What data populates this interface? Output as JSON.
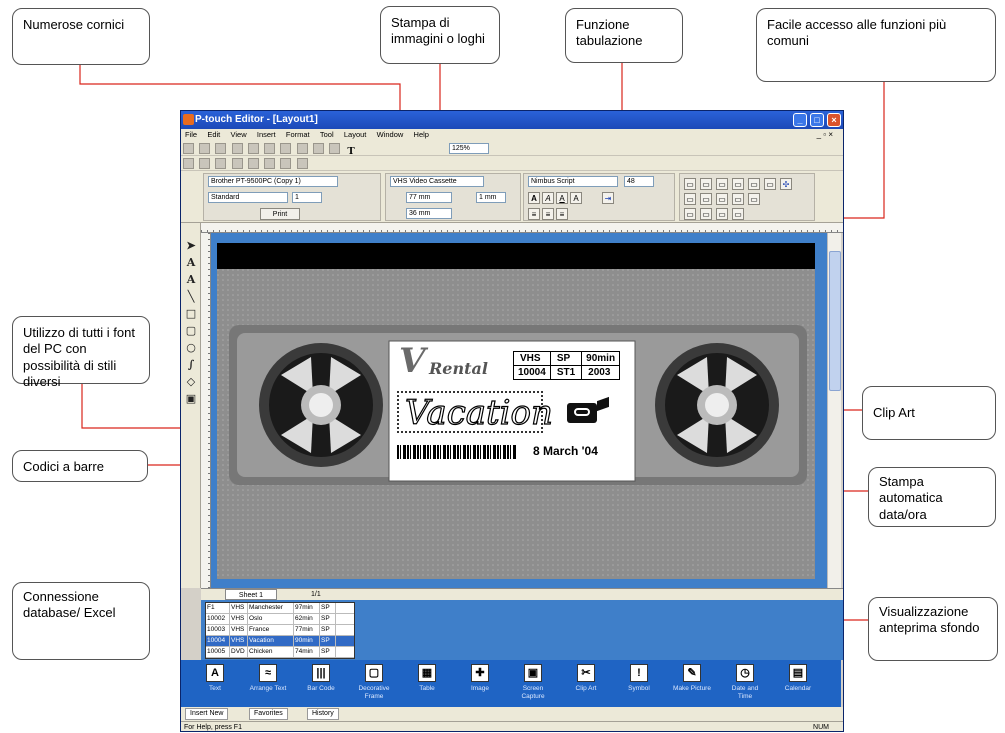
{
  "callouts": {
    "cornici": "Numerose cornici",
    "stampa_immagini": "Stampa di immagini o loghi",
    "tabulazione": "Funzione tabulazione",
    "accesso": "Facile accesso alle funzioni più comuni",
    "font": "Utilizzo di tutti i font del PC con possibilità di stili diversi",
    "clipart": "Clip Art",
    "barcode": "Codici a barre",
    "data_ora": "Stampa automatica data/ora",
    "database": "Connessione database/ Excel",
    "anteprima": "Visualizzazione anteprima sfondo"
  },
  "window": {
    "title": "P-touch Editor - [Layout1]",
    "menu": [
      "File",
      "Edit",
      "View",
      "Insert",
      "Format",
      "Tool",
      "Layout",
      "Window",
      "Help"
    ],
    "zoom": "125%",
    "toolbar_glyph": "T"
  },
  "properties": {
    "printer": "Brother PT-9500PC (Copy 1)",
    "mode": "Standard",
    "copies": "1",
    "print_label": "Print",
    "media": "VHS Video Cassette",
    "width": "77 mm",
    "margin": "1 mm",
    "height": "36 mm",
    "font": "Nimbus Script",
    "font_size": "48"
  },
  "label": {
    "logo_text": "Rental",
    "logo_initial": "V",
    "title_text": "Vacation",
    "table": [
      [
        "VHS",
        "SP",
        "90min"
      ],
      [
        "10004",
        "ST1",
        "2003"
      ]
    ],
    "date": "8 March '04"
  },
  "sheetbar": {
    "sheet": "Sheet 1",
    "page": "1/1"
  },
  "database": {
    "rows": [
      [
        "F1",
        "VHS",
        "Manchester",
        "97min",
        "SP"
      ],
      [
        "10002",
        "VHS",
        "Oslo",
        "62min",
        "SP"
      ],
      [
        "10003",
        "VHS",
        "France",
        "77min",
        "SP"
      ],
      [
        "10004",
        "VHS",
        "Vacation",
        "90min",
        "SP"
      ],
      [
        "10005",
        "DVD",
        "Chicken",
        "74min",
        "SP"
      ]
    ],
    "selected_row": 3
  },
  "gallery": [
    {
      "label": "Text",
      "icon": "text-icon",
      "glyph": "A"
    },
    {
      "label": "Arrange Text",
      "icon": "arrange-text-icon",
      "glyph": "≈"
    },
    {
      "label": "Bar Code",
      "icon": "barcode-icon",
      "glyph": "|||"
    },
    {
      "label": "Decorative Frame",
      "icon": "frame-icon",
      "glyph": "▢"
    },
    {
      "label": "Table",
      "icon": "table-icon",
      "glyph": "▦"
    },
    {
      "label": "Image",
      "icon": "image-icon",
      "glyph": "✚"
    },
    {
      "label": "Screen Capture",
      "icon": "screen-capture-icon",
      "glyph": "▣"
    },
    {
      "label": "Clip Art",
      "icon": "clipart-icon",
      "glyph": "✂"
    },
    {
      "label": "Symbol",
      "icon": "symbol-icon",
      "glyph": "!"
    },
    {
      "label": "Make Picture",
      "icon": "make-picture-icon",
      "glyph": "✎"
    },
    {
      "label": "Date and Time",
      "icon": "date-time-icon",
      "glyph": "◷"
    },
    {
      "label": "Calendar",
      "icon": "calendar-icon",
      "glyph": "▤"
    }
  ],
  "bottom_tabs": [
    "Insert New",
    "Favorites",
    "History"
  ],
  "status": {
    "help": "For Help, press F1",
    "num": "NUM"
  },
  "colors": {
    "titlebar": "#1c49b8",
    "canvas": "#3f7fc9",
    "gallery": "#1f64c4",
    "leader": "#d9261c"
  }
}
